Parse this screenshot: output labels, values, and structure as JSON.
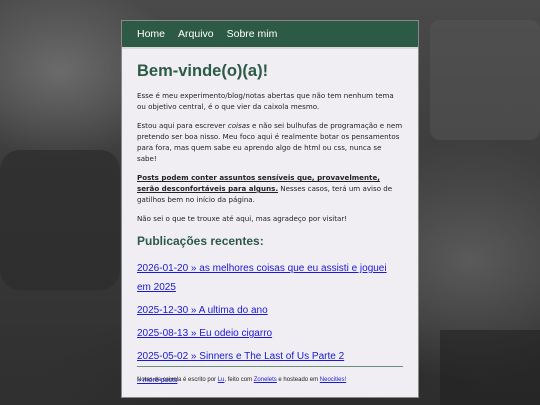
{
  "nav": {
    "home": "Home",
    "archive": "Arquivo",
    "about": "Sobre mim"
  },
  "page": {
    "title": "Bem-vinde(o)(a)!",
    "p1": "Esse é meu experimento/blog/notas abertas que não tem nenhum tema ou objetivo central, é o que vier da caixola mesmo.",
    "p2_pre": "Estou aqui para escrever ",
    "p2_em": "coisas",
    "p2_post": " e não sei bulhufas de programação e nem pretendo ser boa nisso. Meu foco aqui é realmente botar os pensamentos para fora, mas quem sabe eu aprendo algo de html ou css, nunca se sabe!",
    "p3_warn": "Posts podem conter assuntos sensíveis que, provavelmente, serão desconfortáveis para alguns.",
    "p3_rest": " Nesses casos, terá um aviso de gatilhos bem no início da página.",
    "p4": "Não sei o que te trouxe até aqui, mas agradeço por visitar!"
  },
  "recent": {
    "heading": "Publicações recentes:",
    "posts": [
      "2026-01-20 » as melhores coisas que eu assisti e joguei em 2025",
      "2025-12-30 » A ultima do ano",
      "2025-08-13 » Eu odeio cigarro",
      "2025-05-02 » Sinners e The Last of Us Parte 2"
    ],
    "more": "» more posts"
  },
  "footer": {
    "pre": "Notas da caixola é escrito por ",
    "author": "Lu",
    "mid1": ", feito com ",
    "tool": "Zonelets",
    "mid2": " e hosteado em ",
    "host": "Neocities!"
  }
}
